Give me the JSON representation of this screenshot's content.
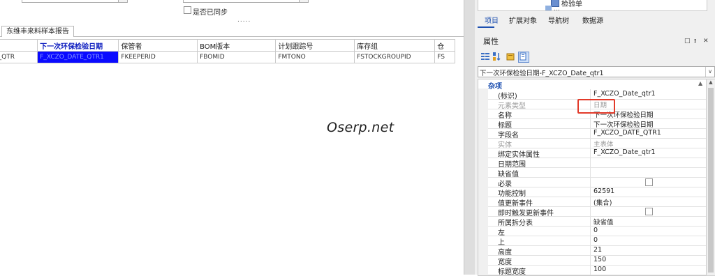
{
  "designer": {
    "sync_label": "是否已同步",
    "splitter_dots": ".....",
    "tab_label": "东维丰来料样本报告",
    "grid": {
      "headers": [
        "",
        "下一次环保检验日期",
        "保管者",
        "BOM版本",
        "计划跟踪号",
        "库存组",
        "仓"
      ],
      "row": [
        "E_QTR",
        "F_XCZO_DATE_QTR1",
        "FKEEPERID",
        "FBOMID",
        "FMTONO",
        "FSTOCKGROUPID",
        "FS"
      ]
    },
    "watermark": "Oserp.net"
  },
  "right": {
    "tree": {
      "item_label": "检验单",
      "item2_label": "..."
    },
    "tabs": [
      "项目",
      "扩展对象",
      "导航树",
      "数据源"
    ],
    "active_tab": "项目",
    "properties": {
      "title": "属性",
      "pin": "□",
      "dock": "ᵻ",
      "close": "✕",
      "object_combo": "下一次环保检验日期-F_XCZO_Date_qtr1",
      "category": "杂项",
      "rows": [
        {
          "name": "(标识)",
          "value": "F_XCZO_Date_qtr1"
        },
        {
          "name": "元素类型",
          "value": "日期"
        },
        {
          "name": "名称",
          "value": "下一次环保检验日期"
        },
        {
          "name": "标题",
          "value": "下一次环保检验日期"
        },
        {
          "name": "字段名",
          "value": "F_XCZO_DATE_QTR1"
        },
        {
          "name": "实体",
          "value": "主表体"
        },
        {
          "name": "绑定实体属性",
          "value": "F_XCZO_Date_qtr1"
        },
        {
          "name": "日期范围",
          "value": ""
        },
        {
          "name": "缺省值",
          "value": ""
        },
        {
          "name": "必录",
          "value": ""
        },
        {
          "name": "功能控制",
          "value": "62591"
        },
        {
          "name": "值更新事件",
          "value": "(集合)"
        },
        {
          "name": "即时触发更新事件",
          "value": ""
        },
        {
          "name": "所属拆分表",
          "value": "缺省值"
        },
        {
          "name": "左",
          "value": "0"
        },
        {
          "name": "上",
          "value": "0"
        },
        {
          "name": "高度",
          "value": "21"
        },
        {
          "name": "宽度",
          "value": "150"
        },
        {
          "name": "标题宽度",
          "value": "100"
        }
      ]
    }
  },
  "colors": {
    "selection_blue": "#0a0aff",
    "accent_blue": "#1e50b0",
    "highlight_red": "#e23a2a"
  }
}
